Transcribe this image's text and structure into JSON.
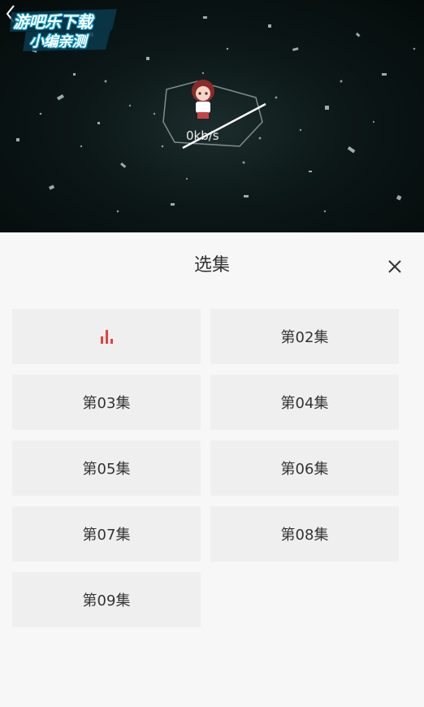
{
  "player": {
    "watermark_line1": "游吧乐下载",
    "watermark_line2": "小编亲测",
    "speed": "0kb/s",
    "back_icon": "chevron-left-icon",
    "loading_icon": "anime-character-loading-icon"
  },
  "sheet": {
    "title": "选集",
    "close_icon": "close-icon",
    "accent_color": "#e63a3a",
    "episodes": [
      {
        "label": "",
        "playing": true,
        "icon": "playing-bars-icon"
      },
      {
        "label": "第02集",
        "playing": false
      },
      {
        "label": "第03集",
        "playing": false
      },
      {
        "label": "第04集",
        "playing": false
      },
      {
        "label": "第05集",
        "playing": false
      },
      {
        "label": "第06集",
        "playing": false
      },
      {
        "label": "第07集",
        "playing": false
      },
      {
        "label": "第08集",
        "playing": false
      },
      {
        "label": "第09集",
        "playing": false
      }
    ]
  }
}
